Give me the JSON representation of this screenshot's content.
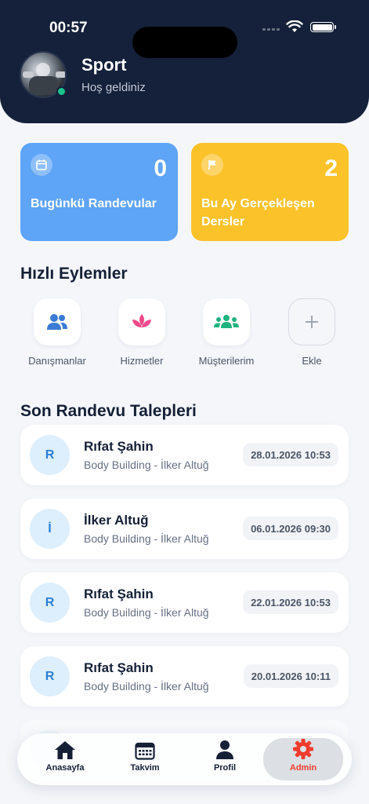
{
  "status_bar": {
    "time": "00:57"
  },
  "header": {
    "name": "Sport",
    "subtitle": "Hoş geldiniz"
  },
  "stats": [
    {
      "label": "Bugünkü Randevular",
      "value": "0",
      "icon": "calendar-icon",
      "color": "#5ea4f7"
    },
    {
      "label": "Bu Ay Gerçekleşen Dersler",
      "value": "2",
      "icon": "flag-icon",
      "color": "#fcc22a"
    }
  ],
  "quick_actions": {
    "title": "Hızlı Eylemler",
    "items": [
      {
        "label": "Danışmanlar",
        "icon": "users-icon",
        "color": "#3a7bd5"
      },
      {
        "label": "Hizmetler",
        "icon": "lotus-icon",
        "color": "#ee4a8a"
      },
      {
        "label": "Müşterilerim",
        "icon": "group-icon",
        "color": "#1fb37f"
      },
      {
        "label": "Ekle",
        "icon": "plus-icon",
        "color": "#a0a6b0"
      }
    ]
  },
  "requests": {
    "title": "Son Randevu Talepleri",
    "items": [
      {
        "initial": "R",
        "name": "Rıfat Şahin",
        "detail": "Body Building - İlker Altuğ",
        "date": "28.01.2026 10:53"
      },
      {
        "initial": "İ",
        "name": "İlker Altuğ",
        "detail": "Body Building - İlker Altuğ",
        "date": "06.01.2026 09:30"
      },
      {
        "initial": "R",
        "name": "Rıfat Şahin",
        "detail": "Body Building - İlker Altuğ",
        "date": "22.01.2026 10:53"
      },
      {
        "initial": "R",
        "name": "Rıfat Şahin",
        "detail": "Body Building - İlker Altuğ",
        "date": "20.01.2026 10:11"
      }
    ]
  },
  "tabs": [
    {
      "label": "Anasayfa",
      "icon": "home-icon"
    },
    {
      "label": "Takvim",
      "icon": "calendar-grid-icon"
    },
    {
      "label": "Profil",
      "icon": "person-icon"
    },
    {
      "label": "Admin",
      "icon": "gear-icon",
      "active": true,
      "color": "#ef3b2d"
    }
  ]
}
